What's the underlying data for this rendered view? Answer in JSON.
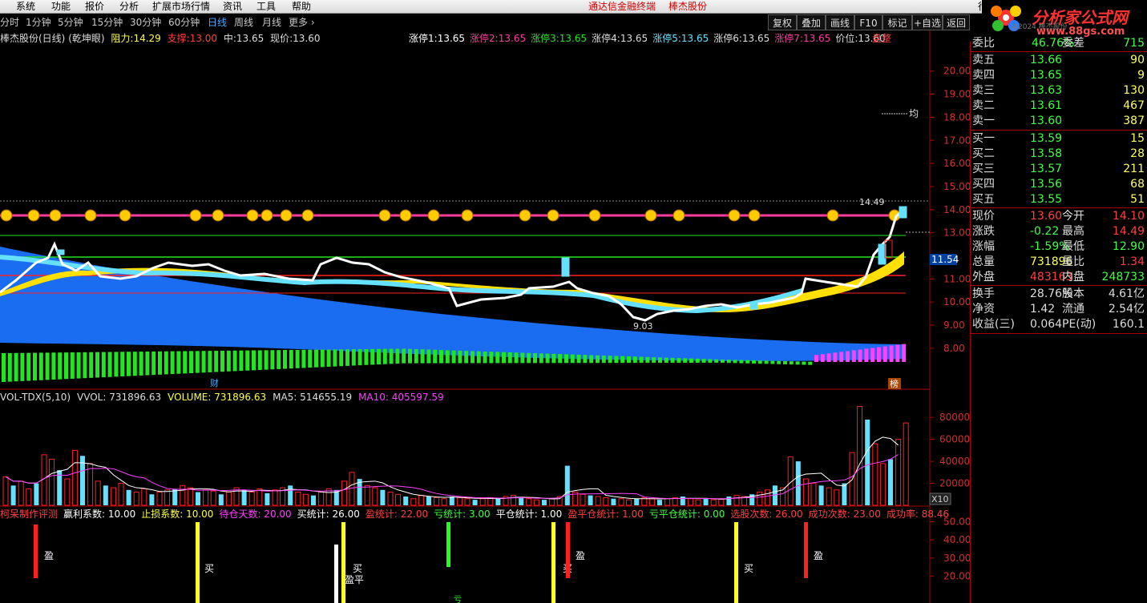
{
  "menu": {
    "items": [
      "系统",
      "功能",
      "报价",
      "分析",
      "扩展市场行情",
      "资讯",
      "工具",
      "帮助"
    ],
    "center_title": "通达信金融终端",
    "center_stock": "棒杰股份",
    "right_text": "行"
  },
  "logo": {
    "text": "分析家公式网",
    "url": "www.88gs.com",
    "caption": "@2024 棒杰股份"
  },
  "timeframes": [
    "分时",
    "1分钟",
    "5分钟",
    "15分钟",
    "30分钟",
    "60分钟",
    "日线",
    "周线",
    "月线",
    "更多 ›"
  ],
  "active_timeframe": 6,
  "toolbar": [
    "复权",
    "叠加",
    "画线",
    "F10",
    "标记",
    "+自选",
    "返回"
  ],
  "header": {
    "stock": "棒杰股份(日线)",
    "indicator": "(乾坤眼)",
    "resist_label": "阻力:",
    "resist": "14.29",
    "support_label": "支撑:",
    "support": "13.00",
    "mid_label": "中:",
    "mid": "13.65",
    "price_label": "现价:",
    "price": "13.60"
  },
  "limit_labels": [
    {
      "label": "涨停1:",
      "value": "13.65",
      "color": "#ffffff"
    },
    {
      "label": "涨停2:",
      "value": "13.65",
      "color": "#ff3ca0"
    },
    {
      "label": "涨停3:",
      "value": "13.65",
      "color": "#22e622"
    },
    {
      "label": "涨停4:",
      "value": "13.65",
      "color": "#dddddd"
    },
    {
      "label": "涨停5:",
      "value": "13.65",
      "color": "#66e0ff"
    },
    {
      "label": "涨停6:",
      "value": "13.65",
      "color": "#dddddd"
    },
    {
      "label": "涨停7:",
      "value": "13.65",
      "color": "#ff3ca0"
    },
    {
      "label": "价位:",
      "value": "13.60",
      "color": "#dddddd"
    }
  ],
  "chart_marker": "盘整",
  "price_axis": [
    {
      "v": 20,
      "t": "20.00"
    },
    {
      "v": 19,
      "t": "19.00"
    },
    {
      "v": 18,
      "t": "18.00"
    },
    {
      "v": 17,
      "t": "17.00"
    },
    {
      "v": 16,
      "t": "16.00"
    },
    {
      "v": 15,
      "t": "15.00"
    },
    {
      "v": 14,
      "t": "14.00"
    },
    {
      "v": 13,
      "t": "13.00"
    },
    {
      "v": 11,
      "t": "11.00"
    },
    {
      "v": 10,
      "t": "10.00"
    },
    {
      "v": 9,
      "t": "9.00"
    },
    {
      "v": 8,
      "t": "8.00"
    }
  ],
  "price_tag": "11.54",
  "annotations": {
    "high": "14.49",
    "low": "9.03",
    "avg": "均",
    "cai": "财",
    "bang": "榜"
  },
  "vol": {
    "name": "VOL-TDX(5,10)",
    "vvol": "VVOL: 731896.63",
    "volume": "VOLUME: 731896.63",
    "ma5": "MA5: 514655.19",
    "ma10": "MA10: 405597.59",
    "axis": [
      {
        "v": 80000,
        "t": "80000"
      },
      {
        "v": 60000,
        "t": "60000"
      },
      {
        "v": 40000,
        "t": "40000"
      },
      {
        "v": 20000,
        "t": "20000"
      }
    ],
    "unit": "X10"
  },
  "system": {
    "fields": [
      {
        "t": "柯呆制作评测",
        "c": "#ff4040"
      },
      {
        "t": "赢利系数: 10.00",
        "c": "#ffffff"
      },
      {
        "t": "止损系数: 10.00",
        "c": "#ffff40"
      },
      {
        "t": "待仓天数: 20.00",
        "c": "#ff40ff"
      },
      {
        "t": "买统计: 26.00",
        "c": "#ffffff"
      },
      {
        "t": "盈统计: 22.00",
        "c": "#ff4040"
      },
      {
        "t": "亏统计: 3.00",
        "c": "#40ff40"
      },
      {
        "t": "平仓统计: 1.00",
        "c": "#ffffff"
      },
      {
        "t": "盈平仓统计: 1.00",
        "c": "#ff4040"
      },
      {
        "t": "亏平仓统计: 0.00",
        "c": "#40ff40"
      },
      {
        "t": "选股次数: 26.00",
        "c": "#ff4040"
      },
      {
        "t": "成功次数: 23.00",
        "c": "#ff4040"
      },
      {
        "t": "成功率: 88.46",
        "c": "#ff4040"
      }
    ],
    "axis": [
      {
        "v": 50,
        "t": "50.00"
      },
      {
        "v": 40,
        "t": "40.00"
      },
      {
        "v": 30,
        "t": "30.00"
      },
      {
        "v": 20,
        "t": "20.00"
      }
    ],
    "sig_labels": {
      "win": "盈",
      "buy": "买",
      "close_win": "盈平",
      "loss": "亏"
    }
  },
  "quote": {
    "webi_label": "委比",
    "webi": "46.76%",
    "weicha_label": "委差",
    "weicha": "715",
    "asks": [
      {
        "l": "卖五",
        "p": "13.66",
        "v": "90"
      },
      {
        "l": "卖四",
        "p": "13.65",
        "v": "9"
      },
      {
        "l": "卖三",
        "p": "13.63",
        "v": "130"
      },
      {
        "l": "卖二",
        "p": "13.61",
        "v": "467"
      },
      {
        "l": "卖一",
        "p": "13.60",
        "v": "387"
      }
    ],
    "bids": [
      {
        "l": "买一",
        "p": "13.59",
        "v": "15"
      },
      {
        "l": "买二",
        "p": "13.58",
        "v": "28"
      },
      {
        "l": "买三",
        "p": "13.57",
        "v": "211"
      },
      {
        "l": "买四",
        "p": "13.56",
        "v": "68"
      },
      {
        "l": "买五",
        "p": "13.55",
        "v": "51"
      }
    ],
    "stats": [
      {
        "l1": "现价",
        "v1": "13.60",
        "c1": "#ff4040",
        "l2": "今开",
        "v2": "14.10",
        "c2": "#ff4040"
      },
      {
        "l1": "涨跌",
        "v1": "-0.22",
        "c1": "#40ff40",
        "l2": "最高",
        "v2": "14.49",
        "c2": "#ff4040"
      },
      {
        "l1": "涨幅",
        "v1": "-1.59%",
        "c1": "#40ff40",
        "l2": "最低",
        "v2": "12.90",
        "c2": "#40ff40"
      },
      {
        "l1": "总量",
        "v1": "731896",
        "c1": "#ffff60",
        "l2": "量比",
        "v2": "1.34",
        "c2": "#ff4040"
      },
      {
        "l1": "外盘",
        "v1": "483163",
        "c1": "#ff4040",
        "l2": "内盘",
        "v2": "248733",
        "c2": "#40ff40"
      }
    ],
    "stats2": [
      {
        "l1": "换手",
        "v1": "28.76%",
        "l2": "股本",
        "v2": "4.61亿"
      },
      {
        "l1": "净资",
        "v1": "1.42",
        "l2": "流通",
        "v2": "2.54亿"
      },
      {
        "l1": "收益(三)",
        "v1": "0.064",
        "l2": "PE(动)",
        "v2": "160.1"
      }
    ]
  },
  "colors": {
    "red": "#ff2020",
    "magenta": "#ff3ca0",
    "green": "#22e622",
    "cyan": "#66e0ff",
    "yellow": "#ffe000",
    "blue": "#1a6cf0"
  }
}
